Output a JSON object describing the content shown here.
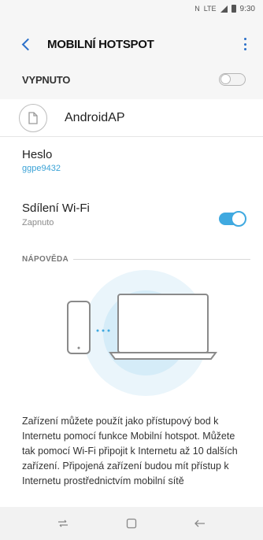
{
  "status_bar": {
    "nfc_icon": "nfc-icon",
    "network_label": "LTE",
    "time": "9:30"
  },
  "header": {
    "title": "MOBILNÍ HOTSPOT",
    "back_icon": "back-arrow-icon",
    "menu_icon": "more-vert-icon"
  },
  "master": {
    "label": "VYPNUTO",
    "enabled": false
  },
  "network": {
    "name": "AndroidAP",
    "icon": "edit-network-icon"
  },
  "password": {
    "title": "Heslo",
    "value": "ggpe9432"
  },
  "wifi_sharing": {
    "title": "Sdílení Wi-Fi",
    "status": "Zapnuto",
    "enabled": true
  },
  "help": {
    "heading": "NÁPOVĚDA",
    "text": "Zařízení můžete použít jako přístupový bod k Internetu pomocí funkce Mobilní hotspot. Můžete tak pomocí Wi-Fi připojit k Internetu až 10 dalších zařízení. Připojená zařízení budou mít přístup k Internetu prostřednictvím mobilní sítě"
  },
  "nav_bar": {
    "recents_icon": "recents-icon",
    "home_icon": "home-icon",
    "back_icon": "back-icon"
  },
  "colors": {
    "accent": "#3fa9e0",
    "header_accent": "#2a6fc9",
    "background": "#f6f6f6",
    "card": "#ffffff"
  }
}
